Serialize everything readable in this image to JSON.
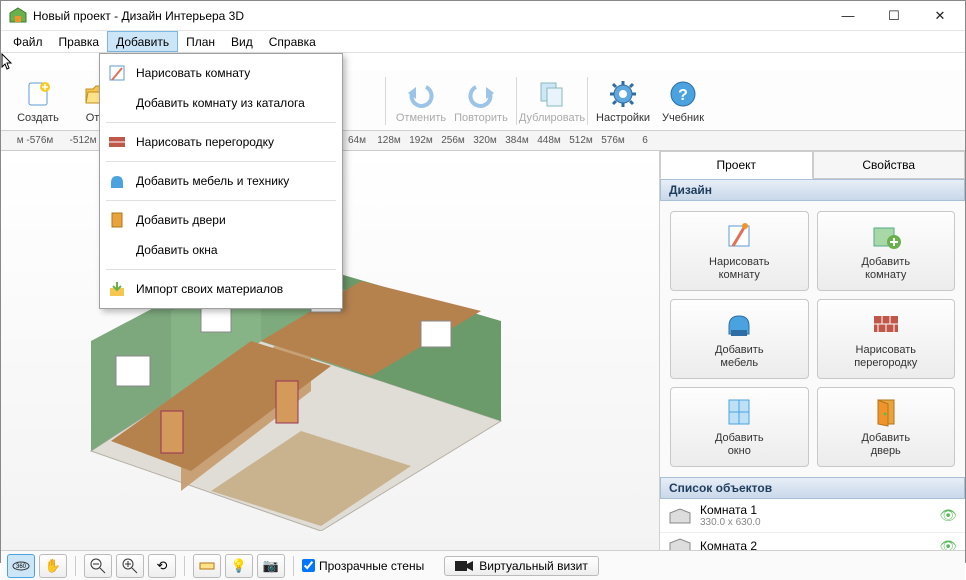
{
  "window": {
    "title": "Новый проект - Дизайн Интерьера 3D"
  },
  "menubar": {
    "items": [
      "Файл",
      "Правка",
      "Добавить",
      "План",
      "Вид",
      "Справка"
    ],
    "active_index": 2
  },
  "dropdown": {
    "items": [
      {
        "label": "Нарисовать комнату",
        "icon": "draw-room"
      },
      {
        "label": "Добавить комнату из каталога",
        "icon": ""
      },
      {
        "sep": true
      },
      {
        "label": "Нарисовать перегородку",
        "icon": "brick"
      },
      {
        "sep": true
      },
      {
        "label": "Добавить мебель и технику",
        "icon": "chair"
      },
      {
        "sep": true
      },
      {
        "label": "Добавить двери",
        "icon": "door"
      },
      {
        "label": "Добавить окна",
        "icon": ""
      },
      {
        "sep": true
      },
      {
        "label": "Импорт своих материалов",
        "icon": "import"
      }
    ]
  },
  "toolbar": {
    "buttons": [
      {
        "label": "Создать",
        "icon": "new",
        "disabled": false
      },
      {
        "label": "Открыть",
        "icon": "open",
        "disabled": false,
        "truncated": "Откр"
      },
      {
        "sep": true
      },
      {
        "label": "Отменить",
        "icon": "undo",
        "disabled": true
      },
      {
        "label": "Повторить",
        "icon": "redo",
        "disabled": true
      },
      {
        "sep": true
      },
      {
        "label": "Дублировать",
        "icon": "duplicate",
        "disabled": true
      },
      {
        "sep": true
      },
      {
        "label": "Настройки",
        "icon": "settings",
        "disabled": false
      },
      {
        "label": "Учебник",
        "icon": "help",
        "disabled": false
      }
    ]
  },
  "ruler": {
    "labels": [
      "м -576м",
      "-512м",
      "64м",
      "128м",
      "192м",
      "256м",
      "320м",
      "384м",
      "448м",
      "512м",
      "576м",
      "6"
    ]
  },
  "side": {
    "tabs": [
      "Проект",
      "Свойства"
    ],
    "active_tab": 0,
    "design_header": "Дизайн",
    "buttons": [
      {
        "l1": "Нарисовать",
        "l2": "комнату",
        "icon": "draw-room"
      },
      {
        "l1": "Добавить",
        "l2": "комнату",
        "icon": "add-room"
      },
      {
        "l1": "Добавить",
        "l2": "мебель",
        "icon": "chair"
      },
      {
        "l1": "Нарисовать",
        "l2": "перегородку",
        "icon": "brick"
      },
      {
        "l1": "Добавить",
        "l2": "окно",
        "icon": "window"
      },
      {
        "l1": "Добавить",
        "l2": "дверь",
        "icon": "door"
      }
    ],
    "objects_header": "Список объектов",
    "objects": [
      {
        "name": "Комната 1",
        "dim": "330.0 x 630.0"
      },
      {
        "name": "Комната 2",
        "dim": ""
      }
    ]
  },
  "bottombar": {
    "transparent_walls": "Прозрачные стены",
    "virtual_visit": "Виртуальный визит"
  }
}
